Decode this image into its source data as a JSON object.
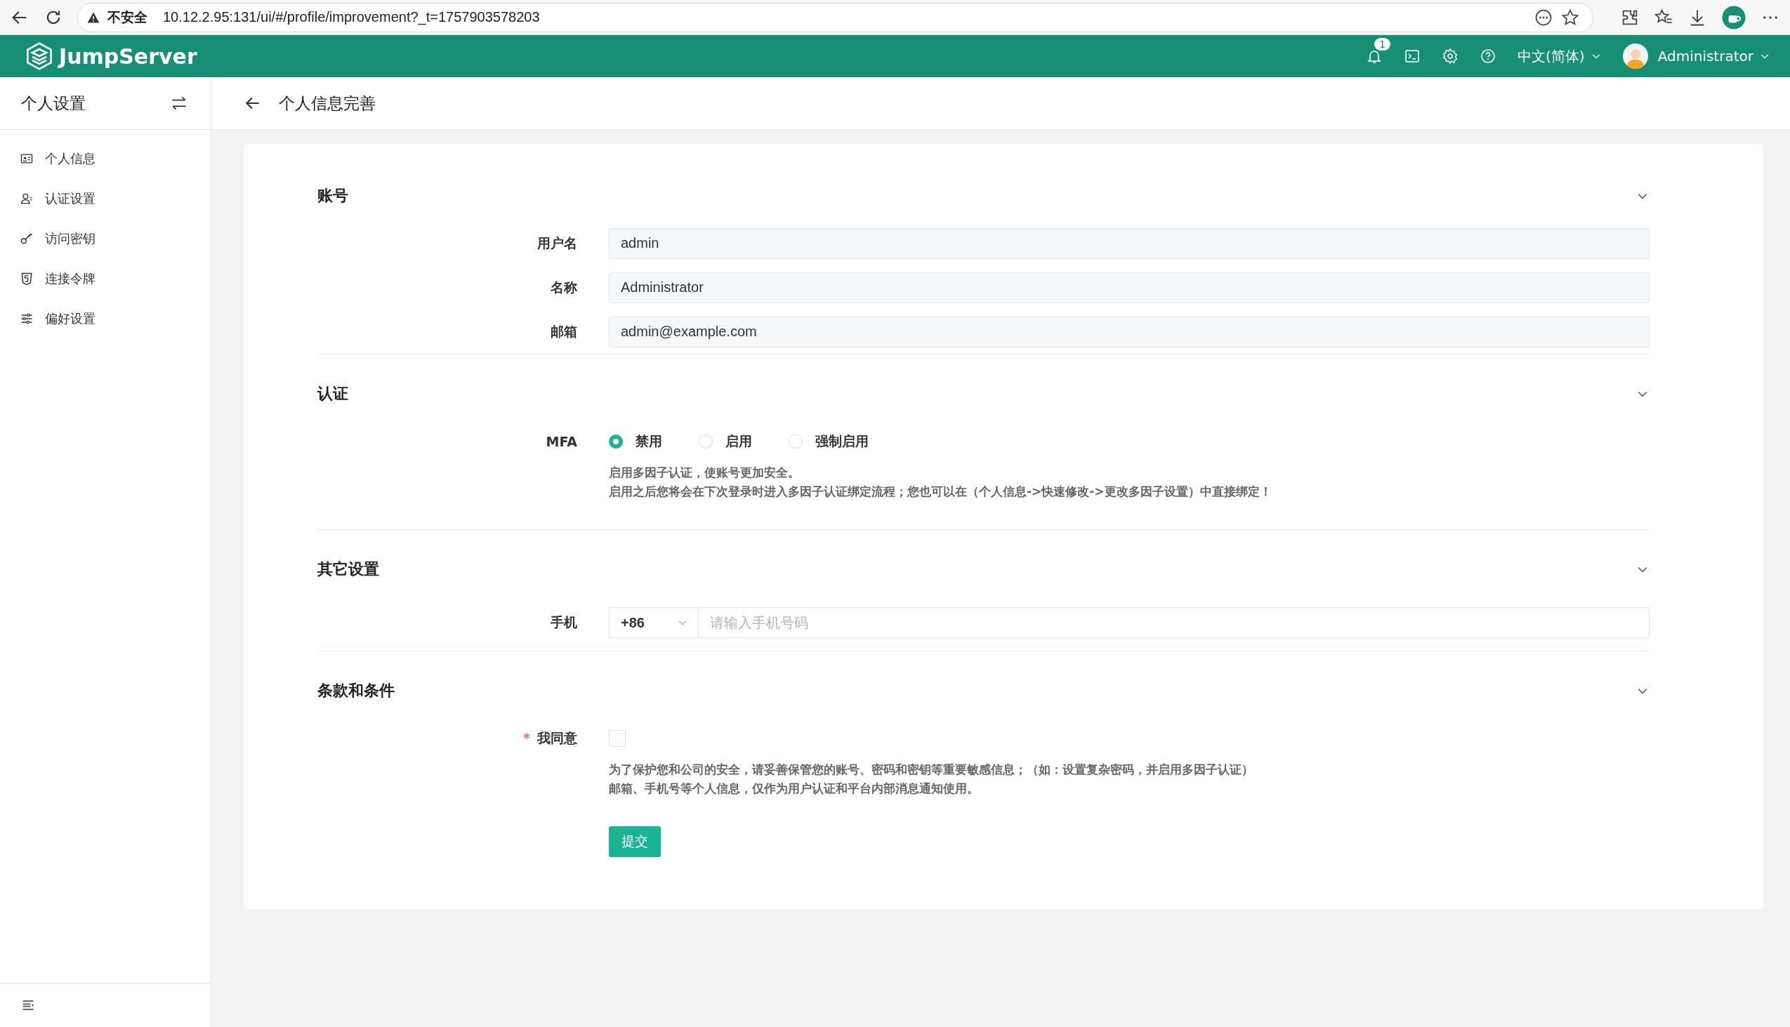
{
  "browser": {
    "security": "不安全",
    "url": "10.12.2.95:131/ui/#/profile/improvement?_t=1757903578203"
  },
  "header": {
    "brand": "JumpServer",
    "notification_count": "1",
    "language": "中文(简体)",
    "user": "Administrator"
  },
  "sidebar": {
    "title": "个人设置",
    "items": [
      {
        "label": "个人信息",
        "selected": false
      },
      {
        "label": "认证设置",
        "selected": false
      },
      {
        "label": "访问密钥",
        "selected": false
      },
      {
        "label": "连接令牌",
        "selected": false
      },
      {
        "label": "偏好设置",
        "selected": false
      }
    ]
  },
  "page": {
    "title": "个人信息完善"
  },
  "sections": [
    {
      "kind": "fields",
      "title": "账号",
      "expanded": true,
      "fields": [
        {
          "label": "用户名",
          "value": "admin",
          "disabled": true
        },
        {
          "label": "名称",
          "value": "Administrator",
          "disabled": true
        },
        {
          "label": "邮箱",
          "value": "admin@example.com",
          "disabled": true
        }
      ]
    },
    {
      "kind": "radio",
      "title": "认证",
      "expanded": true,
      "label": "MFA",
      "options": [
        {
          "label": "禁用",
          "selected": true
        },
        {
          "label": "启用",
          "selected": false
        },
        {
          "label": "强制启用",
          "selected": false
        }
      ],
      "help": [
        "启用多因子认证，使账号更加安全。",
        "启用之后您将会在下次登录时进入多因子认证绑定流程；您也可以在（个人信息->快速修改->更改多因子设置）中直接绑定！"
      ]
    },
    {
      "kind": "phone",
      "title": "其它设置",
      "expanded": true,
      "label": "手机",
      "country_code": "+86",
      "placeholder": "请输入手机号码"
    },
    {
      "kind": "agreement",
      "title": "条款和条件",
      "expanded": true,
      "label": "我同意",
      "required_mark": "*",
      "checked": false,
      "help": [
        "为了保护您和公司的安全，请妥善保管您的账号、密码和密钥等重要敏感信息；（如：设置复杂密码，并启用多因子认证）",
        "邮箱、手机号等个人信息，仅作为用户认证和平台内部消息通知使用。"
      ],
      "button": "提交"
    }
  ]
}
